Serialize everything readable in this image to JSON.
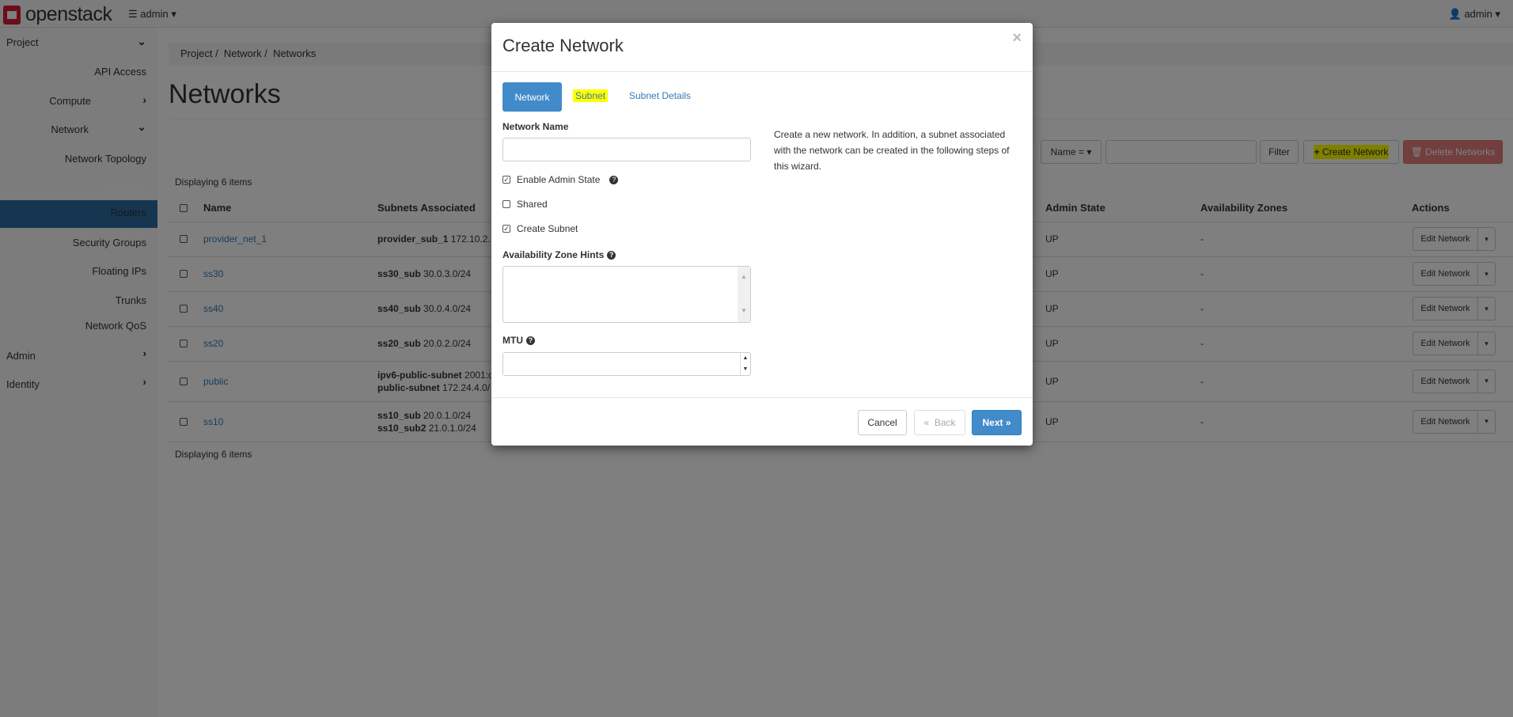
{
  "topbar": {
    "brand": "openstack",
    "project": "admin",
    "user": "admin"
  },
  "sidebar": {
    "project": "Project",
    "api_access": "API Access",
    "compute": "Compute",
    "network": "Network",
    "network_topology": "Network Topology",
    "networks": "Networks",
    "routers": "Routers",
    "security_groups": "Security Groups",
    "floating_ips": "Floating IPs",
    "trunks": "Trunks",
    "network_qos": "Network QoS",
    "admin": "Admin",
    "identity": "Identity"
  },
  "breadcrumb": [
    "Project",
    "Network",
    "Networks"
  ],
  "page_title": "Networks",
  "toolbar": {
    "filter_field": "Name =",
    "filter_value": "",
    "filter_label": "Filter",
    "create_label": "Create Network",
    "delete_label": "Delete Networks"
  },
  "table": {
    "count": "Displaying 6 items",
    "headers": [
      "Name",
      "Subnets Associated",
      "Admin State",
      "Availability Zones",
      "Actions"
    ],
    "rows": [
      {
        "name": "provider_net_1",
        "subnets": [
          {
            "n": "provider_sub_1",
            "c": "172.10.2."
          }
        ],
        "state": "UP",
        "az": "-",
        "action": "Edit Network"
      },
      {
        "name": "ss30",
        "subnets": [
          {
            "n": "ss30_sub",
            "c": "30.0.3.0/24"
          }
        ],
        "state": "UP",
        "az": "-",
        "action": "Edit Network"
      },
      {
        "name": "ss40",
        "subnets": [
          {
            "n": "ss40_sub",
            "c": "30.0.4.0/24"
          }
        ],
        "state": "UP",
        "az": "-",
        "action": "Edit Network"
      },
      {
        "name": "ss20",
        "subnets": [
          {
            "n": "ss20_sub",
            "c": "20.0.2.0/24"
          }
        ],
        "state": "UP",
        "az": "-",
        "action": "Edit Network"
      },
      {
        "name": "public",
        "subnets": [
          {
            "n": "ipv6-public-subnet",
            "c": "2001:c"
          },
          {
            "n": "public-subnet",
            "c": "172.24.4.0/"
          }
        ],
        "state": "UP",
        "az": "-",
        "action": "Edit Network"
      },
      {
        "name": "ss10",
        "subnets": [
          {
            "n": "ss10_sub",
            "c": "20.0.1.0/24"
          },
          {
            "n": "ss10_sub2",
            "c": "21.0.1.0/24"
          }
        ],
        "state": "UP",
        "az": "-",
        "action": "Edit Network"
      }
    ]
  },
  "modal": {
    "title": "Create Network",
    "tabs": [
      "Network",
      "Subnet",
      "Subnet Details"
    ],
    "network_name_label": "Network Name",
    "network_name_value": "",
    "enable_admin_state": "Enable Admin State",
    "shared": "Shared",
    "create_subnet": "Create Subnet",
    "az_hints_label": "Availability Zone Hints",
    "mtu_label": "MTU",
    "mtu_value": "",
    "description": "Create a new network. In addition, a subnet associated with the network can be created in the following steps of this wizard.",
    "cancel": "Cancel",
    "back": "Back",
    "next": "Next"
  },
  "colors": {
    "primary": "#428bca",
    "danger": "#d9534f",
    "highlight": "#ffff00"
  }
}
